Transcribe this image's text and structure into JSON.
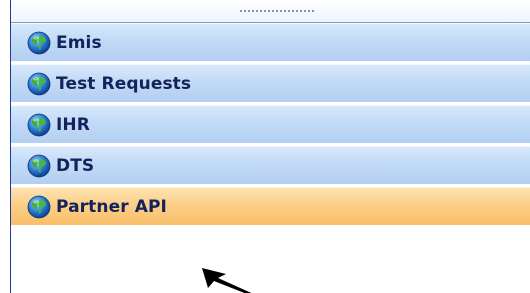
{
  "nav": {
    "items": [
      {
        "label": "Emis",
        "icon": "globe-icon",
        "selected": false
      },
      {
        "label": "Test Requests",
        "icon": "globe-icon",
        "selected": false
      },
      {
        "label": "IHR",
        "icon": "globe-icon",
        "selected": false
      },
      {
        "label": "DTS",
        "icon": "globe-icon",
        "selected": false
      },
      {
        "label": "Partner API",
        "icon": "globe-icon",
        "selected": true
      }
    ]
  },
  "colors": {
    "item_bg": "#c2daf6",
    "selected_bg": "#fccf88",
    "label_text": "#13235c",
    "border": "#1b3f8a"
  }
}
